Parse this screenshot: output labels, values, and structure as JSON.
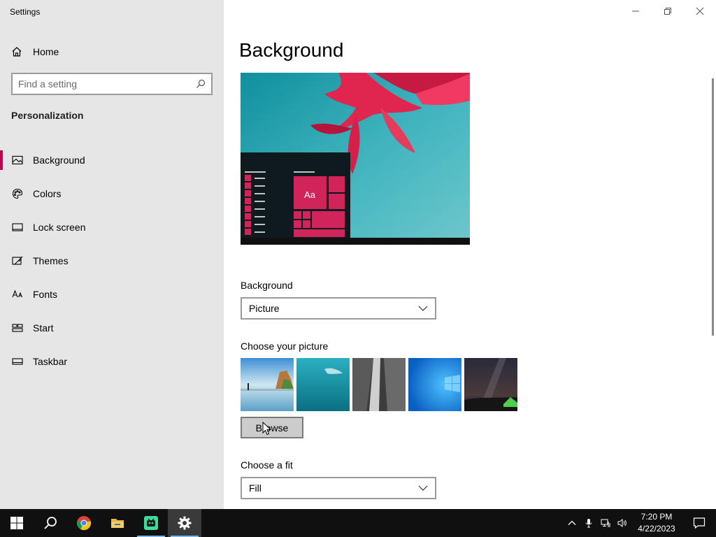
{
  "window": {
    "title": "Settings",
    "controls": [
      "minimize",
      "restore",
      "close"
    ]
  },
  "sidebar": {
    "home_label": "Home",
    "search_placeholder": "Find a setting",
    "section_title": "Personalization",
    "items": [
      {
        "label": "Background",
        "icon": "picture-icon",
        "active": true
      },
      {
        "label": "Colors",
        "icon": "palette-icon",
        "active": false
      },
      {
        "label": "Lock screen",
        "icon": "lock-screen-icon",
        "active": false
      },
      {
        "label": "Themes",
        "icon": "themes-icon",
        "active": false
      },
      {
        "label": "Fonts",
        "icon": "fonts-icon",
        "active": false
      },
      {
        "label": "Start",
        "icon": "start-icon",
        "active": false
      },
      {
        "label": "Taskbar",
        "icon": "taskbar-icon",
        "active": false
      }
    ]
  },
  "main": {
    "title": "Background",
    "preview": {
      "tile_label": "Aa"
    },
    "background_label": "Background",
    "background_value": "Picture",
    "choose_picture_label": "Choose your picture",
    "browse_label": "Browse",
    "choose_fit_label": "Choose a fit",
    "fit_value": "Fill"
  },
  "taskbar": {
    "apps": [
      {
        "name": "start-button",
        "icon": "windows-logo-icon"
      },
      {
        "name": "search-button",
        "icon": "search-icon"
      },
      {
        "name": "chrome",
        "icon": "chrome-icon"
      },
      {
        "name": "file-explorer",
        "icon": "folder-icon"
      },
      {
        "name": "app-green",
        "icon": "robot-app-icon"
      },
      {
        "name": "settings",
        "icon": "gear-icon"
      }
    ],
    "clock": {
      "time": "7:20 PM",
      "date": "4/22/2023"
    }
  },
  "colors": {
    "accent": "#c30052",
    "sidebar_bg": "#e6e6e6",
    "taskbar_bg": "#101010"
  }
}
